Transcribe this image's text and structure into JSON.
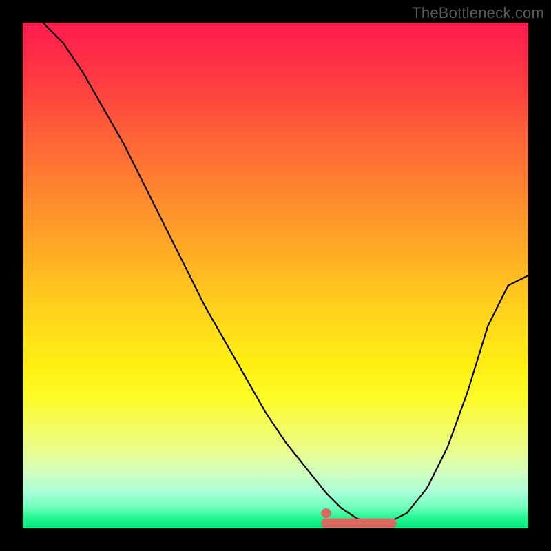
{
  "watermark": "TheBottleneck.com",
  "chart_data": {
    "type": "line",
    "title": "",
    "xlabel": "",
    "ylabel": "",
    "xlim": [
      0,
      100
    ],
    "ylim": [
      0,
      100
    ],
    "grid": false,
    "legend": false,
    "note": "No axis ticks or labels visible; background gradient encodes value (red high, green low).",
    "series": [
      {
        "name": "curve",
        "x": [
          4,
          8,
          12,
          16,
          20,
          24,
          28,
          32,
          36,
          40,
          44,
          48,
          52,
          56,
          60,
          63,
          66,
          69,
          72,
          76,
          80,
          84,
          88,
          92,
          96,
          100
        ],
        "y": [
          100,
          96,
          90,
          83,
          76,
          68,
          60,
          52,
          44,
          37,
          30,
          23,
          17,
          12,
          7,
          4,
          2,
          1,
          1,
          3,
          8,
          16,
          27,
          40,
          48,
          50
        ]
      }
    ],
    "highlight_segment": {
      "name": "salmon-band",
      "x_range": [
        60,
        73
      ],
      "y": 1,
      "color": "#d96a62",
      "start_dot": {
        "x": 60,
        "y": 3
      }
    },
    "gradient_colors": {
      "top": "#ff1c4f",
      "mid": "#ffc21f",
      "bottom": "#00e97c"
    }
  }
}
